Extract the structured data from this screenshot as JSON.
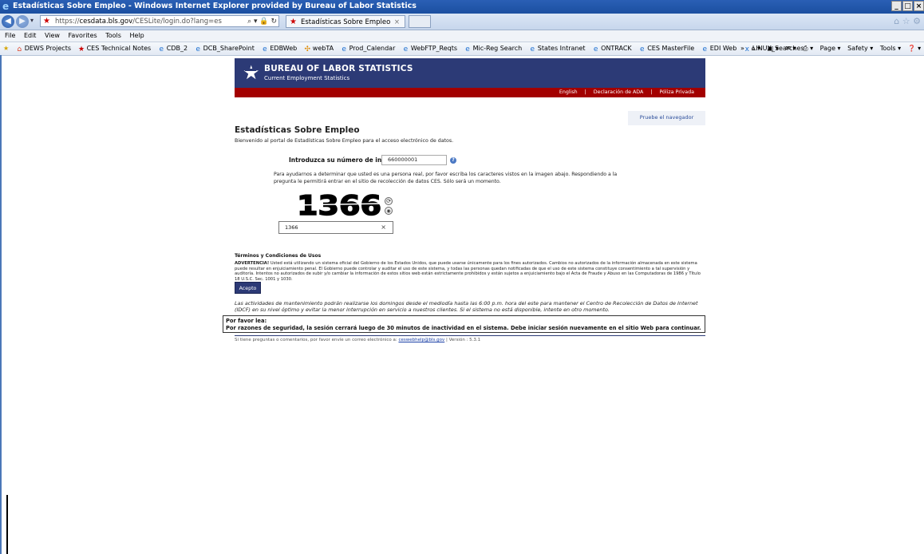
{
  "window": {
    "title": "Estadísticas Sobre Empleo - Windows Internet Explorer provided by Bureau of Labor Statistics",
    "controls": [
      "_",
      "□",
      "×"
    ]
  },
  "address_bar": {
    "url_prefix": "https://",
    "url_domain": "cesdata.bls.gov",
    "url_path": "/CESLite/login.do?lang=es",
    "tools": "⌕ ▾ 🔒 ↻"
  },
  "tab": {
    "label": "Estadísticas Sobre Empleo",
    "close": "×"
  },
  "menu": [
    "File",
    "Edit",
    "View",
    "Favorites",
    "Tools",
    "Help"
  ],
  "favorites": [
    {
      "icon": "⌂",
      "label": "DEWS Projects"
    },
    {
      "icon": "★",
      "label": "CES Technical Notes"
    },
    {
      "icon": "e",
      "label": "CDB_2"
    },
    {
      "icon": "e",
      "label": "DCB_SharePoint"
    },
    {
      "icon": "e",
      "label": "EDBWeb"
    },
    {
      "icon": "✣",
      "label": "webTA"
    },
    {
      "icon": "e",
      "label": "Prod_Calendar"
    },
    {
      "icon": "e",
      "label": "WebFTP_Reqts"
    },
    {
      "icon": "e",
      "label": "Mic-Reg Search"
    },
    {
      "icon": "e",
      "label": "States Intranet"
    },
    {
      "icon": "e",
      "label": "ONTRACK"
    },
    {
      "icon": "e",
      "label": "CES MasterFile"
    },
    {
      "icon": "e",
      "label": "EDI Web"
    },
    {
      "icon": "x",
      "label": "LINUX_Searches"
    }
  ],
  "command_bar": [
    "»",
    "⌂ ▾",
    "▣ ▾",
    "✉ ▾",
    "⎙ ▾",
    "Page ▾",
    "Safety ▾",
    "Tools ▾",
    "❓ ▾"
  ],
  "banner": {
    "title": "BUREAU OF LABOR STATISTICS",
    "subtitle": "Current Employment Statistics"
  },
  "top_links": [
    "English",
    "Declaración de ADA",
    "Póliza Privada"
  ],
  "test_browser": "Pruebe el navegador",
  "page": {
    "title": "Estadísticas Sobre Empleo",
    "welcome": "Bienvenido al portal de Estadísticas Sobre Empleo para el acceso electrónico de datos."
  },
  "form": {
    "ces_label": "Introduzca su número de informe de CES:",
    "ces_value": "660000001",
    "help": "?",
    "instructions": "Para ayudarnos a determinar que usted es una persona real, por favor escriba los caracteres vistos en la imagen abajo. Respondiendo a la pregunta le permitirá entrar en el sitio de recolección de datos CES. Sólo será un momento.",
    "captcha_text": "1366",
    "captcha_value": "1366",
    "clear": "×"
  },
  "terms": {
    "title": "Términos y Condiciones de Usos",
    "warning_label": "ADVERTENCIA!",
    "warning": " Usted está utilizando un sistema oficial del Gobierno de los Estados Unidos, que puede usarse únicamente para los fines autorizados. Cambios no autorizados de la información almacenada en este sistema puede resultar en enjuiciamiento penal. El Gobierno puede controlar y auditar el uso de este sistema, y todas las personas quedan notificadas de que el uso de este sistema constituye consentimiento a tal supervisión y auditoría. Intentos no autorizados de subir y/o cambiar la información de estos sitios web están estrictamente prohibidos y están sujetos a enjuiciamiento bajo el Acta de Fraude y Abuso en las Computadoras de 1986 y Título 18 U.S.C. Sec. 1001 y 1030.",
    "accept": "Acepto"
  },
  "maintenance": "Las actividades de mantenimiento podrán realizarse los domingos desde el mediodía hasta las 6:00 p.m. hora del este para mantener el Centro de Recolección de Datos de Internet (IDCF) en su nivel óptimo y evitar la menor interrupción en servicio a nuestros clientes. Si el sistema no está disponible, intente en otro momento.",
  "notice": {
    "line1": "Por favor lea:",
    "line2": "Por razones de seguridad, la sesión cerrará luego de 30 minutos de inactividad en el sistema. Debe iniciar sesión nuevamente en el sitio Web para continuar."
  },
  "footer": {
    "text": "Si tiene preguntas o comentarios, por favor envíe un correo electrónico a: ",
    "email": "ceswebhelp@bls.gov",
    "version": " | Versión : 5.3.1"
  }
}
